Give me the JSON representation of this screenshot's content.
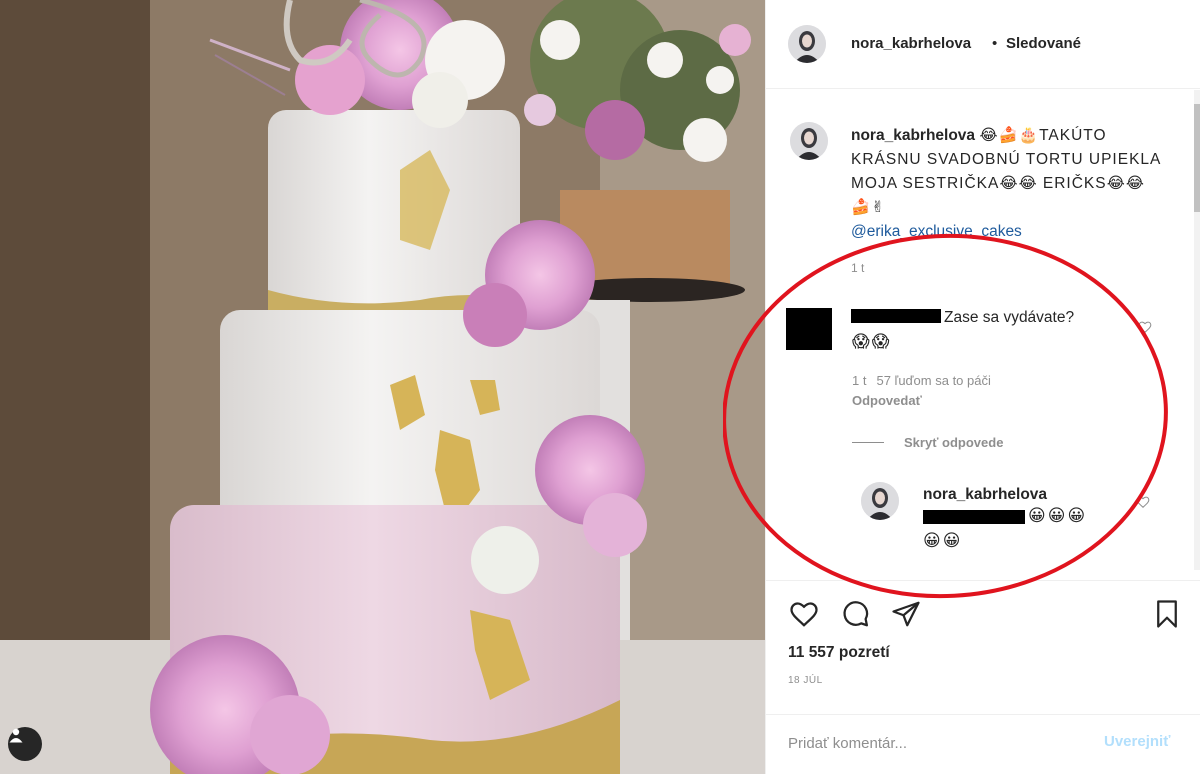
{
  "post": {
    "username": "nora_kabrhelova",
    "separator": "•",
    "follow_status": "Sledované",
    "caption_user": "nora_kabrhelova",
    "caption_text": "😂🍰🎂TAKÚTO KRÁSNU SVADOBNÚ TORTU UPIEKLA MOJA SESTRIČKA😂😂 ERIČKS😂😂🍰✌",
    "caption_mention": "@erika_exclusive_cakes",
    "caption_time": "1 t"
  },
  "comments": [
    {
      "text": "Zase sa vydávate?",
      "emoji": "😱😱",
      "time": "1 t",
      "likes": "57 ľuďom sa to páči",
      "reply_label": "Odpovedať",
      "hide_replies": "Skryť odpovede",
      "replies": [
        {
          "username": "nora_kabrhelova",
          "emoji_line1": "😀😀😀",
          "emoji_line2": "😀😀"
        }
      ]
    }
  ],
  "stats": {
    "views": "11 557 pozretí",
    "date": "18 JÚL"
  },
  "comment_box": {
    "placeholder": "Pridať komentár...",
    "post_label": "Uverejniť"
  },
  "icons": {
    "like": "heart-icon",
    "comment": "comment-bubble-icon",
    "share": "paper-plane-icon",
    "save": "bookmark-icon",
    "user_tag": "user-tag-icon"
  },
  "colors": {
    "highlight": "#e0141e",
    "link": "#1e5a9c",
    "muted": "#8e8e8e",
    "post_button_disabled": "#b2dffc"
  }
}
